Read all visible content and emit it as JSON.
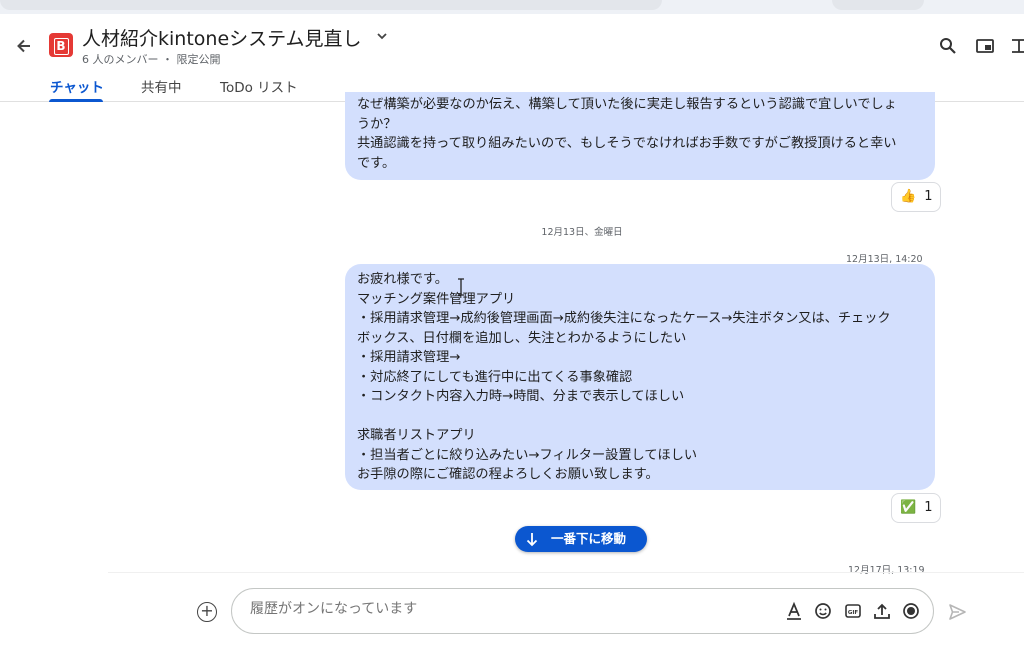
{
  "header": {
    "space_avatar_letter": "B",
    "space_title": "人材紹介kintoneシステム見直し",
    "subtitle": "6 人のメンバー ・ 限定公開",
    "tabs": [
      {
        "label": "チャット",
        "active": true
      },
      {
        "label": "共有中",
        "active": false
      },
      {
        "label": "ToDo リスト",
        "active": false
      }
    ],
    "accent_color": "#0b57d0",
    "avatar_color": "#e53935"
  },
  "messages": [
    {
      "lines": [
        "なぜ構築が必要なのか伝え、構築して頂いた後に実走し報告するという認識で宜しいでしょ",
        "うか？",
        "共通認識を持って取り組みたいので、もしそうでなければお手数ですがご教授頂けると幸い",
        "です。"
      ],
      "reaction": {
        "emoji": "👍",
        "count": "1"
      }
    },
    {
      "timestamp": "12月13日, 14:20",
      "lines": [
        "お疲れ様です。",
        "マッチング案件管理アプリ",
        "・採用請求管理→成約後管理画面→成約後失注になったケース→失注ボタン又は、チェック",
        "ボックス、日付欄を追加し、失注とわかるようにしたい",
        "・採用請求管理→",
        "・対応終了にしても進行中に出てくる事象確認",
        "・コンタクト内容入力時→時間、分まで表示してほしい",
        "",
        "求職者リストアプリ",
        "・担当者ごとに絞り込みたい→フィルター設置してほしい",
        "お手隙の際にご確認の程よろしくお願い致します。"
      ],
      "reaction": {
        "emoji": "✅",
        "count": "1"
      }
    }
  ],
  "date_divider": "12月13日、金曜日",
  "next_timestamp": "12月17日, 13:19",
  "jump_button": "一番下に移動",
  "compose": {
    "placeholder": "履歴がオンになっています",
    "icons": [
      "format-text-icon",
      "emoji-icon",
      "gif-icon",
      "upload-icon",
      "record-icon"
    ]
  },
  "bubble_color": "#d3dffd"
}
